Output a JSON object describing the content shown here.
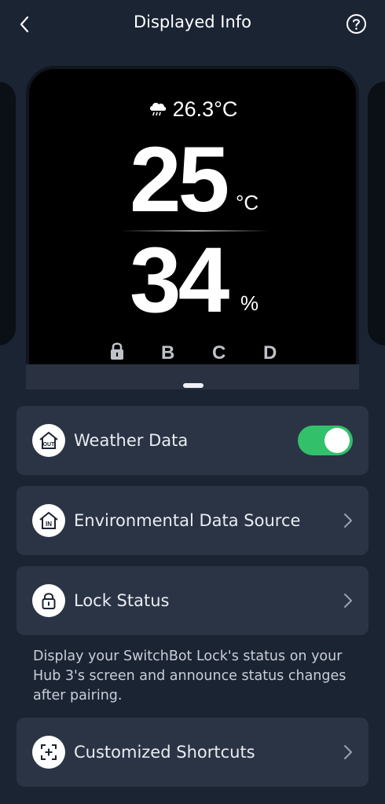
{
  "header": {
    "title": "Displayed Info",
    "back_icon": "chevron-left-icon",
    "help_icon": "question-circle-icon"
  },
  "preview": {
    "weather_icon": "cloud-rain-icon",
    "weather_temp": "26.3°C",
    "temperature": "25",
    "temperature_unit": "°C",
    "humidity": "34",
    "humidity_unit": "%",
    "slots": {
      "a_icon": "lock-icon",
      "b": "B",
      "c": "C",
      "d": "D"
    }
  },
  "settings": {
    "weather": {
      "label": "Weather Data",
      "icon": "home-out-icon",
      "enabled": true,
      "toggle_color": "#33c06a"
    },
    "environmental": {
      "label": "Environmental Data Source",
      "icon": "home-in-icon"
    },
    "lock": {
      "label": "Lock Status",
      "icon": "lock-icon",
      "description": "Display your SwitchBot Lock's status on your Hub 3's screen and announce status changes after pairing."
    },
    "shortcuts": {
      "label": "Customized Shortcuts",
      "icon": "shortcut-plus-icon"
    }
  },
  "colors": {
    "background": "#1b2433",
    "card": "#2b3445",
    "accent_green": "#33c06a"
  }
}
